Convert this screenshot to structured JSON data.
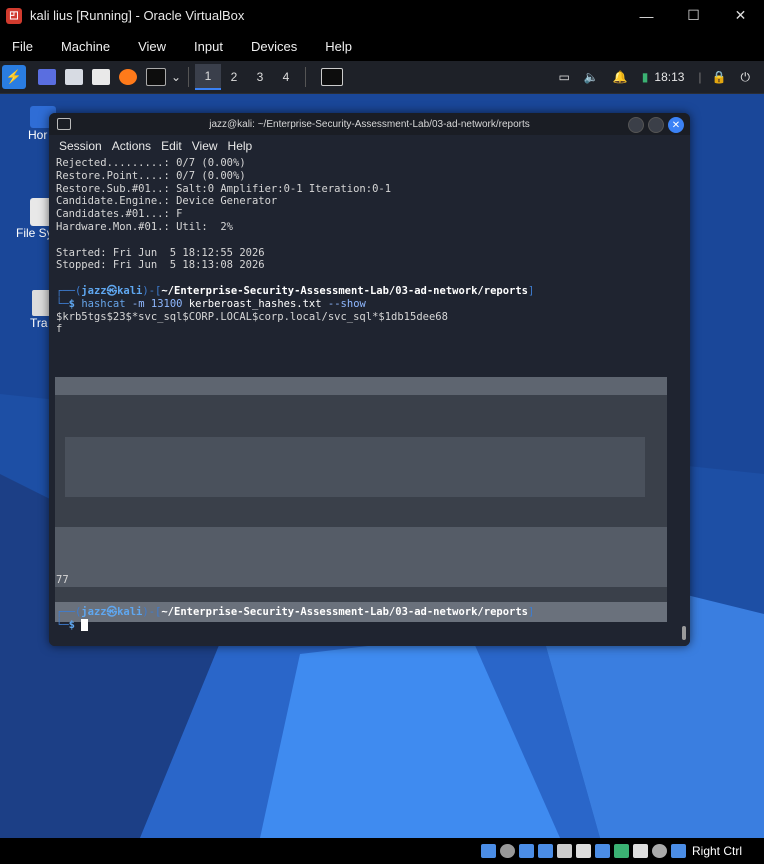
{
  "window": {
    "title": "kali lius [Running] - Oracle VirtualBox",
    "controls": [
      "—",
      "☐",
      "✕"
    ]
  },
  "menu": [
    "File",
    "Machine",
    "View",
    "Input",
    "Devices",
    "Help"
  ],
  "panel": {
    "workspaces": [
      "1",
      "2",
      "3",
      "4"
    ],
    "active_workspace": "1",
    "clock": "18:13",
    "dropdown_glyph": "⌄"
  },
  "desktop": {
    "icons": [
      "Hor",
      "File Sy",
      "Tra"
    ]
  },
  "terminal": {
    "title": "jazz@kali: ~/Enterprise-Security-Assessment-Lab/03-ad-network/reports",
    "menu": [
      "Session",
      "Actions",
      "Edit",
      "View",
      "Help"
    ],
    "lines": [
      "Rejected.........: 0/7 (0.00%)",
      "Restore.Point....: 0/7 (0.00%)",
      "Restore.Sub.#01..: Salt:0 Amplifier:0-1 Iteration:0-1",
      "Candidate.Engine.: Device Generator",
      "Candidates.#01...: F",
      "Hardware.Mon.#01.: Util:  2%",
      "",
      "Started: Fri Jun  5 18:12:55 2026",
      "Stopped: Fri Jun  5 18:13:08 2026"
    ],
    "prompt": {
      "corner_top": "┌──(",
      "user": "jazz",
      "at": "㉿",
      "host": "kali",
      "mid": ")-[",
      "path": "~/Enterprise-Security-Assessment-Lab/03-ad-network/reports",
      "end": "]",
      "corner_bottom": "└─",
      "dollar": "$"
    },
    "command": {
      "cmd": "hashcat",
      "opt": "-m 13100",
      "file": "kerberoast_hashes.txt",
      "flag": "--show"
    },
    "hash_line": "$krb5tgs$23$*svc_sql$CORP.LOCAL$corp.local/svc_sql*$1db15dee68",
    "redacted_tail_first": "f",
    "redacted_tail_last": "77"
  },
  "statusbar": {
    "right_ctrl": "Right Ctrl"
  },
  "colors": {
    "terminal_bg": "#1f2430",
    "prompt_blue": "#3e7dd1",
    "desktop_blue": "#1d4fa5"
  }
}
